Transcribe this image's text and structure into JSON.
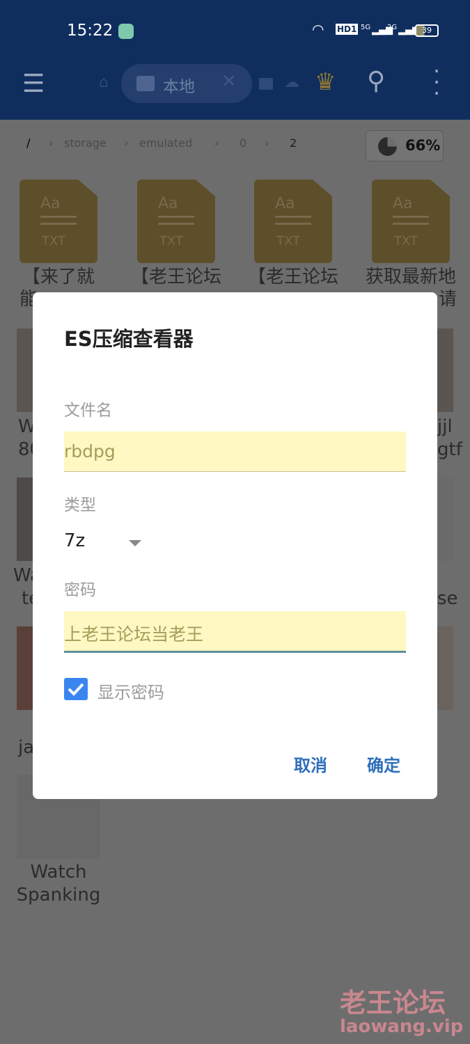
{
  "status_bar": {
    "time": "15:22",
    "icons": [
      "app-notification-icon",
      "wifi-icon",
      "hd-icon",
      "5g-signal-icon",
      "2g-signal-icon",
      "battery-icon"
    ],
    "hd": "HD1",
    "net1": "5G",
    "net2": "2G",
    "battery": "39"
  },
  "toolbar": {
    "tab_label": "本地",
    "icons": [
      "menu-icon",
      "home-icon",
      "sd-card-icon",
      "close-icon",
      "sd-card-icon",
      "cloud-icon",
      "crown-icon",
      "search-icon",
      "more-icon"
    ]
  },
  "breadcrumb": {
    "items": [
      "/",
      "storage",
      "emulated",
      "0",
      "2"
    ],
    "storage_percent": "66%"
  },
  "files": {
    "txt_label": "TXT",
    "txt_glyph": "Aa",
    "row1": [
      "【来了就",
      "【老王论坛",
      "【老王论坛",
      "获取最新地"
    ],
    "row1_line2_left": "能",
    "row1_line2_right": "请",
    "row2_left": [
      "W",
      "80"
    ],
    "row2_right": [
      "jjl",
      "gtf"
    ],
    "row3_left": [
      "Wa",
      "te"
    ],
    "row3_right": [
      "se"
    ],
    "row4_left": [
      "ja"
    ],
    "row5": [
      "Watch",
      "Spanking"
    ]
  },
  "dialog": {
    "title": "ES压缩查看器",
    "filename_label": "文件名",
    "filename_value": "rbdpg",
    "type_label": "类型",
    "type_value": "7z",
    "password_label": "密码",
    "password_value": "上老王论坛当老王",
    "show_password_label": "显示密码",
    "show_password_checked": true,
    "cancel": "取消",
    "ok": "确定",
    "accent": "#2f6fba"
  },
  "watermark": {
    "line1": "老王论坛",
    "line2": "laowang.vip"
  }
}
